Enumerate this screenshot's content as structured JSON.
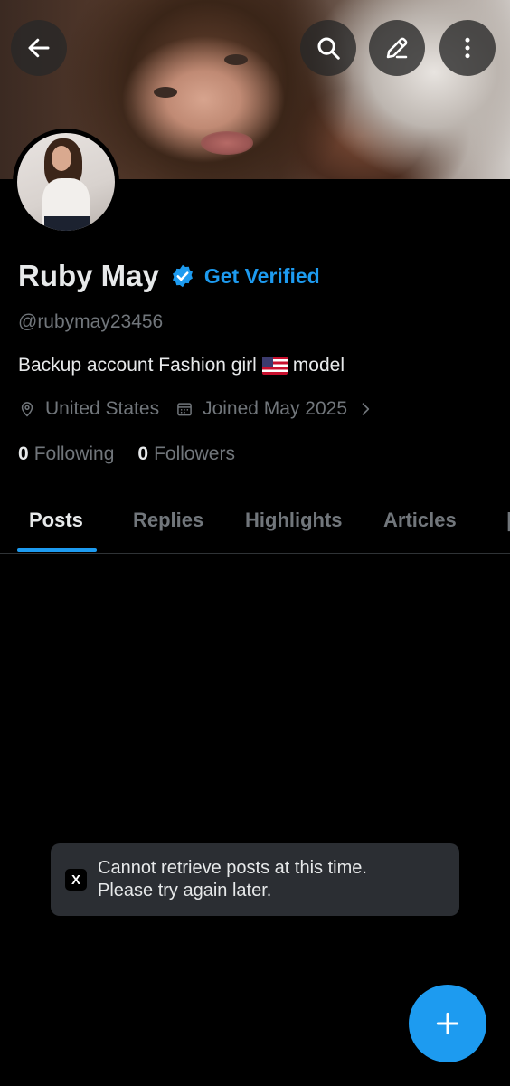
{
  "header": {
    "back_icon": "arrow-left-icon",
    "search_icon": "search-icon",
    "edit_icon": "pencil-icon",
    "more_icon": "more-vertical-icon"
  },
  "profile": {
    "name": "Ruby May",
    "verified_icon": "verified-badge-icon",
    "get_verified_label": "Get Verified",
    "handle": "@rubymay23456",
    "bio_before_flag": "Backup account Fashion girl",
    "bio_flag": "us-flag-emoji",
    "bio_after_flag": "model",
    "location": "United States",
    "joined": "Joined May 2025",
    "following_count": "0",
    "following_label": "Following",
    "followers_count": "0",
    "followers_label": "Followers"
  },
  "tabs": [
    {
      "label": "Posts",
      "active": true
    },
    {
      "label": "Replies",
      "active": false
    },
    {
      "label": "Highlights",
      "active": false
    },
    {
      "label": "Articles",
      "active": false
    }
  ],
  "toast": {
    "logo": "X",
    "line1": "Cannot retrieve posts at this time.",
    "line2": "Please try again later."
  },
  "fab": {
    "icon": "plus-icon"
  },
  "colors": {
    "accent": "#1d9bf0",
    "background": "#000000",
    "secondary_text": "#71767b",
    "primary_text": "#e7e9ea"
  }
}
